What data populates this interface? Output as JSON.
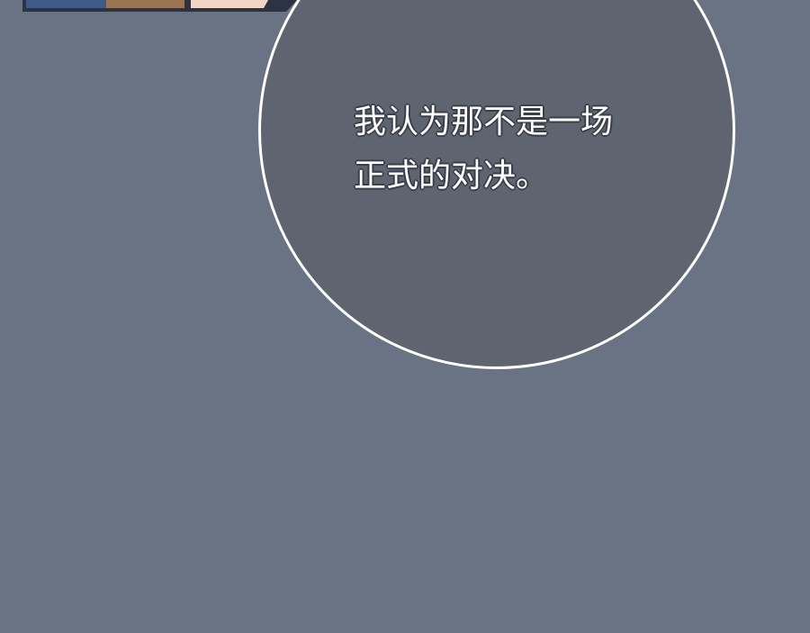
{
  "dialogue": {
    "line_1": "我认为那不是一场",
    "line_2": "正式的对决。"
  },
  "colors": {
    "background": "#6a7384",
    "bubble_fill": "#5f6471",
    "bubble_border": "#ffffff",
    "text": "#ffffff"
  }
}
